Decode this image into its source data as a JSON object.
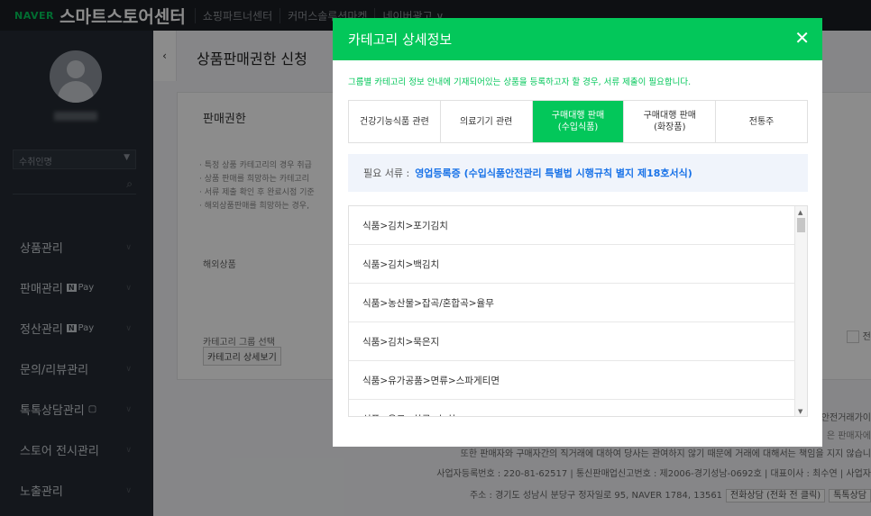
{
  "topbar": {
    "brand_naver": "NAVER",
    "brand_title": "스마트스토어센터",
    "nav": [
      "쇼핑파트너센터",
      "커머스솔루션마켓",
      "네이버광고 ∨"
    ]
  },
  "sidebar": {
    "store_placeholder": "수취인명",
    "menu": [
      {
        "label": "상품관리"
      },
      {
        "label": "판매관리",
        "badge": "Pay"
      },
      {
        "label": "정산관리",
        "badge": "Pay"
      },
      {
        "label": "문의/리뷰관리"
      },
      {
        "label": "톡톡상담관리"
      },
      {
        "label": "스토어 전시관리"
      },
      {
        "label": "노출관리"
      }
    ]
  },
  "main": {
    "page_title": "상품판매권한 신청",
    "card_head": "판매권한",
    "notices": [
      "· 특정 상품 카테고리의 경우 취급",
      "· 상품 판매를 희망하는 카테고리",
      "· 서류 제출 확인 후 완료시점 기준",
      "· 해외상품판매를 희망하는 경우,"
    ],
    "overseas_label": "해외상품",
    "category_group_label": "카테고리 그룹 선택",
    "category_detail_button": "카테고리 상세보기",
    "right_check_label": "전통"
  },
  "footer": {
    "line1": "안전거래가이",
    "line2": "은 판매자에",
    "line3": "또한 판매자와 구매자간의 직거래에 대하여 당사는 관여하지 않기 때문에 거래에 대해서는 책임을 지지 않습니",
    "line4": "사업자등록번호 : 220-81-62517 | 통신판매업신고번호 : 제2006-경기성남-0692호 | 대표이사 : 최수연 | 사업자",
    "line5": "주소 : 경기도 성남시 분당구 정자일로 95, NAVER 1784, 13561",
    "phone_tag": "전화상담 (전화 전 클릭)",
    "talk_tag": "톡톡상담"
  },
  "modal": {
    "title": "카테고리 상세정보",
    "close_icon": "close-icon",
    "note": "그룹별 카테고리 정보 안내에 기재되어있는 상품을 등록하고자 할 경우, 서류 제출이 필요합니다.",
    "tabs": [
      {
        "label": "건강기능식품 관련",
        "active": false
      },
      {
        "label": "의료기기 관련",
        "active": false
      },
      {
        "label": "구매대행 판매\n(수입식품)",
        "active": true
      },
      {
        "label": "구매대행 판매\n(화장품)",
        "active": false
      },
      {
        "label": "전통주",
        "active": false
      }
    ],
    "docs_label": "필요 서류 :",
    "docs_value": "영업등록증 (수입식품안전관리 특별법 시행규칙 별지 제18호서식)",
    "categories": [
      "식품>김치>포기김치",
      "식품>김치>백김치",
      "식품>농산물>잡곡/혼합곡>율무",
      "식품>김치>묵은지",
      "식품>유가공품>면류>스파게티면",
      "식품>음료>차류>녹차"
    ]
  },
  "colors": {
    "accent": "#03c75a",
    "link": "#1a73e8",
    "sidebar_bg": "#252b33",
    "topbar_bg": "#1a1e24"
  }
}
